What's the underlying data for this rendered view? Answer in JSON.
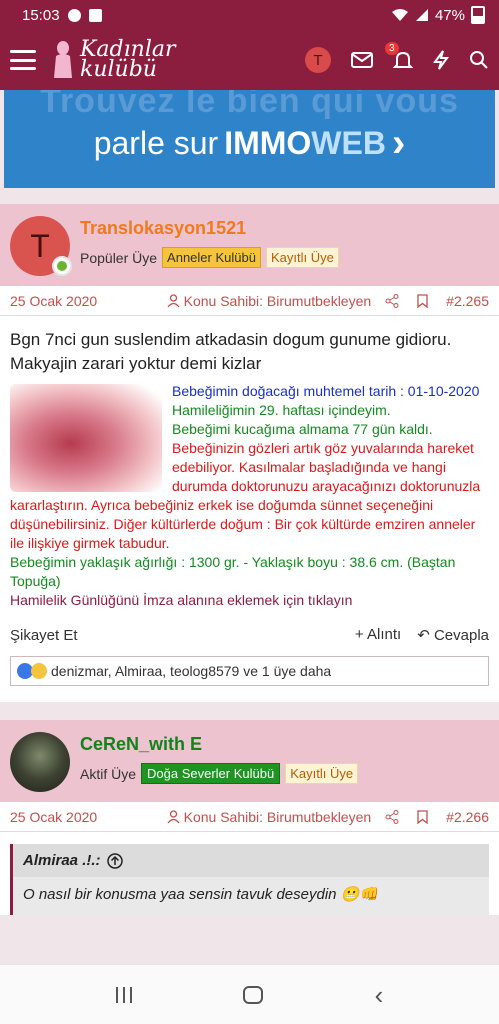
{
  "status": {
    "time": "15:03",
    "battery": "47%"
  },
  "header": {
    "logo_line1": "Kadınlar",
    "logo_line2": "kulübü",
    "user_initial": "T",
    "notif_count": "3"
  },
  "ad": {
    "top_text": "Trouvez le bien qui vous",
    "main_text": "parle sur",
    "brand_1": "IMMO",
    "brand_2": "WEB",
    "arrow": "›"
  },
  "posts": [
    {
      "username": "Translokasyon1521",
      "avatar_initial": "T",
      "role": "Popüler Üye",
      "badge_1": "Anneler Kulübü",
      "badge_2": "Kayıtlı Üye",
      "date": "25 Ocak 2020",
      "author": "Konu Sahibi: Birumutbekleyen",
      "number": "#2.265",
      "text": "Bgn 7nci gun suslendim atkadasin dogum gunume gidioru. Makyajin zarari yoktur demi kizlar",
      "sig_blue": "Bebeğimin doğacağı muhtemel tarih : 01-10-2020",
      "sig_green_1": "Hamileliğimin 29. haftası içindeyim.",
      "sig_green_2": "Bebeğimi kucağıma almama 77 gün kaldı.",
      "sig_red": "Bebeğinizin gözleri artık göz yuvalarında hareket edebiliyor. Kasılmalar başladığında ve hangi durumda doktorunuzu arayacağınızı doktorunuzla kararlaştırın. Ayrıca bebeğiniz erkek ise doğumda sünnet seçeneğini düşünebilirsiniz. Diğer kültürlerde doğum : Bir çok kültürde emziren anneler ile ilişkiye girmek tabudur.",
      "sig_green_3": "Bebeğimin yaklaşık ağırlığı : 1300 gr. - Yaklaşık boyu : 38.6 cm. (Baştan Topuğa)",
      "sig_link": "Hamilelik Günlüğünü İmza alanına eklemek için tıklayın",
      "report": "Şikayet Et",
      "quote_btn": "Alıntı",
      "reply_btn": "Cevapla",
      "likes": "denizmar, Almiraa, teolog8579 ve 1 üye daha"
    },
    {
      "username": "CeReN_with E",
      "role": "Aktif Üye",
      "badge_1": "Doğa Severler Kulübü",
      "badge_2": "Kayıtlı Üye",
      "date": "25 Ocak 2020",
      "author": "Konu Sahibi: Birumutbekleyen",
      "number": "#2.266",
      "quote_author": "Almiraa .!.:",
      "quote_text": "O nasıl bir konusma yaa sensin tavuk deseydin 😬👊"
    }
  ]
}
